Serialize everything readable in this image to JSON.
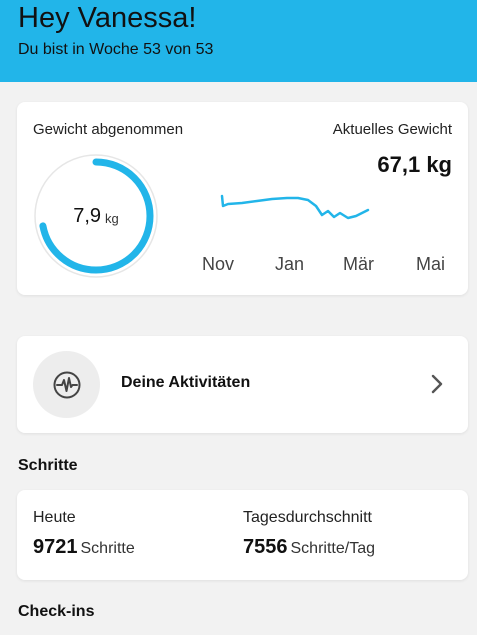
{
  "header": {
    "greeting": "Hey Vanessa!",
    "week_text": "Du bist in Woche 53 von 53",
    "background_color": "#22b5e9"
  },
  "weight": {
    "lost_label": "Gewicht abgenommen",
    "lost_value": "7,9",
    "lost_unit": "kg",
    "ring_progress_fraction": 0.72,
    "current_label": "Aktuelles Gewicht",
    "current_value": "67,1 kg",
    "trend_color": "#22b5e9",
    "axis_months": [
      "Nov",
      "Jan",
      "Mär",
      "Mai"
    ]
  },
  "activity": {
    "label": "Deine Aktivitäten",
    "icon": "activity-pulse-icon",
    "chevron_icon": "chevron-right-icon"
  },
  "steps": {
    "section_title": "Schritte",
    "today_label": "Heute",
    "today_value": "9721",
    "today_unit": "Schritte",
    "avg_label": "Tagesdurchschnitt",
    "avg_value": "7556",
    "avg_unit": "Schritte/Tag"
  },
  "checkins": {
    "section_title": "Check-ins"
  }
}
